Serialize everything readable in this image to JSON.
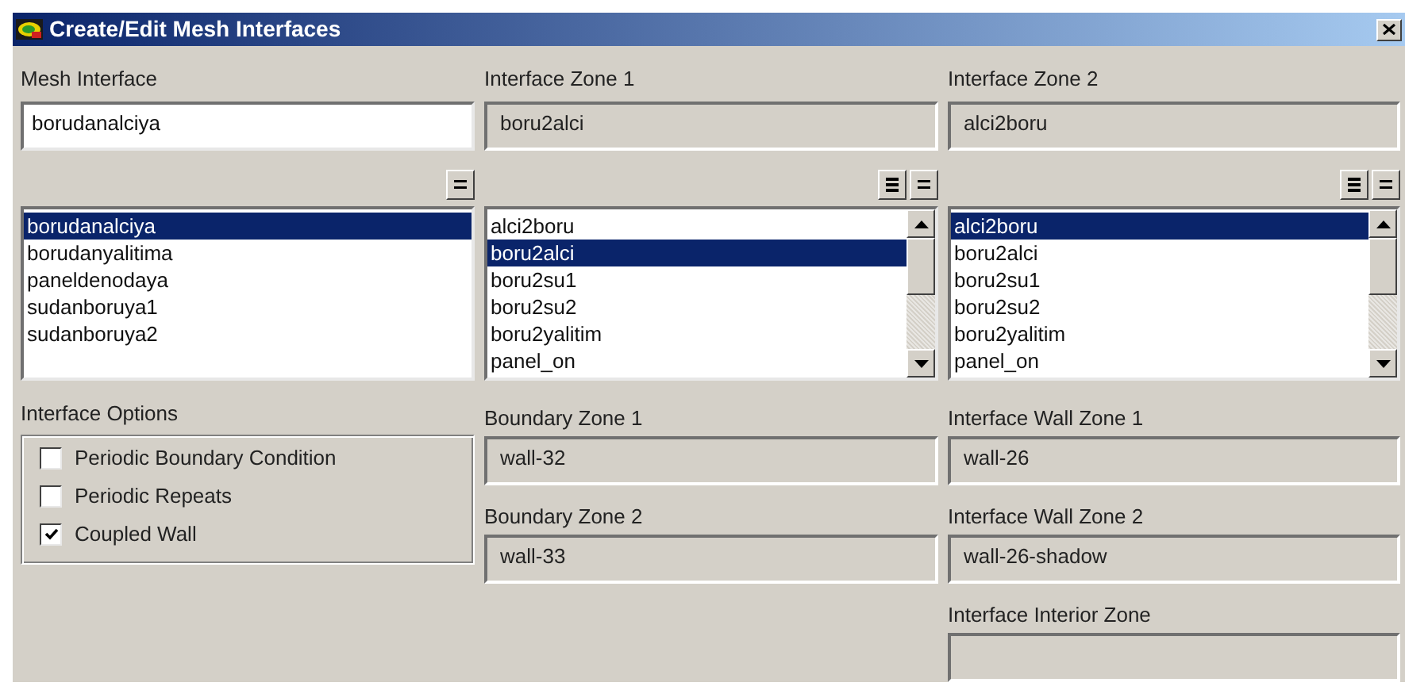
{
  "window": {
    "title": "Create/Edit Mesh Interfaces"
  },
  "mesh_interface": {
    "label": "Mesh Interface",
    "value": "borudanalciya",
    "items": [
      {
        "label": "borudanalciya",
        "selected": true
      },
      {
        "label": "borudanyalitima",
        "selected": false
      },
      {
        "label": "paneldenodaya",
        "selected": false
      },
      {
        "label": "sudanboruya1",
        "selected": false
      },
      {
        "label": "sudanboruya2",
        "selected": false
      }
    ]
  },
  "interface_zone_1": {
    "label": "Interface Zone 1",
    "value": "boru2alci",
    "items": [
      {
        "label": "alci2boru",
        "selected": false
      },
      {
        "label": "boru2alci",
        "selected": true
      },
      {
        "label": "boru2su1",
        "selected": false
      },
      {
        "label": "boru2su2",
        "selected": false
      },
      {
        "label": "boru2yalitim",
        "selected": false
      },
      {
        "label": "panel_on",
        "selected": false
      }
    ]
  },
  "interface_zone_2": {
    "label": "Interface Zone 2",
    "value": "alci2boru",
    "items": [
      {
        "label": "alci2boru",
        "selected": true
      },
      {
        "label": "boru2alci",
        "selected": false
      },
      {
        "label": "boru2su1",
        "selected": false
      },
      {
        "label": "boru2su2",
        "selected": false
      },
      {
        "label": "boru2yalitim",
        "selected": false
      },
      {
        "label": "panel_on",
        "selected": false
      }
    ]
  },
  "interface_options": {
    "label": "Interface Options",
    "options": [
      {
        "label": "Periodic Boundary Condition",
        "checked": false
      },
      {
        "label": "Periodic Repeats",
        "checked": false
      },
      {
        "label": "Coupled Wall",
        "checked": true
      }
    ]
  },
  "boundary_zones": [
    {
      "label": "Boundary Zone 1",
      "value": "wall-32"
    },
    {
      "label": "Boundary Zone 2",
      "value": "wall-33"
    }
  ],
  "interface_zones": [
    {
      "label": "Interface Wall Zone 1",
      "value": "wall-26"
    },
    {
      "label": "Interface Wall Zone 2",
      "value": "wall-26-shadow"
    },
    {
      "label": "Interface Interior Zone"
    }
  ]
}
